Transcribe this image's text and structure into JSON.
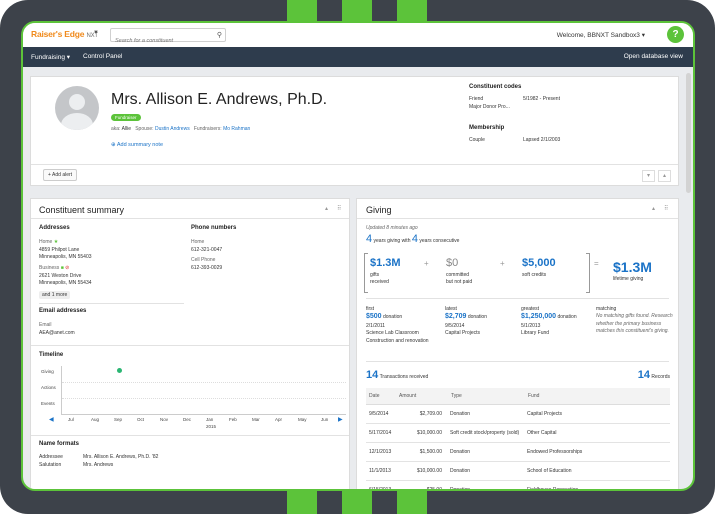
{
  "header": {
    "logo": "Raiser's Edge",
    "logo_suffix": "NXT",
    "search_placeholder": "Search for a constituent",
    "welcome": "Welcome, BBNXT Sandbox3",
    "help": "?"
  },
  "nav": {
    "fundraising": "Fundraising",
    "control_panel": "Control Panel",
    "open_db": "Open database view"
  },
  "profile": {
    "name": "Mrs. Allison E. Andrews, Ph.D.",
    "tag": "Fundraiser",
    "aka_label": "aka:",
    "aka_value": "Allie",
    "spouse_label": "Spouse:",
    "spouse_value": "Dustin Andrews",
    "fundraisers_label": "Fundraisers:",
    "fundraisers_value": "Mo Rahman",
    "add_summary": "Add summary note",
    "add_alert": "Add alert",
    "codes_title": "Constituent codes",
    "codes": [
      {
        "name": "Friend",
        "value": "5/1982 - Present"
      },
      {
        "name": "Major Donor Pro...",
        "value": ""
      }
    ],
    "membership_title": "Membership",
    "membership": {
      "type": "Couple",
      "status": "Lapsed 2/1/2003"
    }
  },
  "summary": {
    "title": "Constituent summary",
    "addresses_title": "Addresses",
    "home_label": "Home",
    "home_line1": "4859 Philpot Lane",
    "home_line2": "Minneapolis, MN 55403",
    "business_label": "Business",
    "business_line1": "2621 Wexton Drive",
    "business_line2": "Minneapolis, MN 55434",
    "more": "and 1 more",
    "phones_title": "Phone numbers",
    "phone_home_label": "Home",
    "phone_home": "612-321-0047",
    "phone_cell_label": "Cell Phone",
    "phone_cell": "612-393-0029",
    "email_title": "Email addresses",
    "email_label": "Email",
    "email_value": "AEA@anet.com",
    "timeline_title": "Timeline",
    "timeline_rows": [
      "Giving",
      "Actions",
      "Events"
    ],
    "timeline_months": [
      "Jul",
      "Aug",
      "Sep",
      "Oct",
      "Nov",
      "Dec",
      "Jan",
      "Feb",
      "Mar",
      "Apr",
      "May",
      "Jun"
    ],
    "timeline_year": "2015",
    "nameformats_title": "Name formats",
    "addressee_label": "Addressee",
    "addressee_value": "Mrs. Allison E. Andrews, Ph.D. '82",
    "salutation_label": "Salutation",
    "salutation_value": "Mrs. Andrews"
  },
  "giving": {
    "title": "Giving",
    "updated": "Updated 8 minutes ago",
    "years_giving": "4",
    "years_giving_text": "years giving with",
    "years_consec": "4",
    "years_consec_text": "years consecutive",
    "gifts_received_value": "$1.3M",
    "gifts_received_label1": "gifts",
    "gifts_received_label2": "received",
    "committed_value": "$0",
    "committed_label1": "committed",
    "committed_label2": "but not paid",
    "soft_value": "$5,000",
    "soft_label": "soft credits",
    "lifetime_value": "$1.3M",
    "lifetime_label": "lifetime giving",
    "first_title": "first",
    "first_amount": "$500",
    "first_type": "donation",
    "first_date": "2/1/2011",
    "first_fund": "Science Lab Classroom Construction and renovation",
    "latest_title": "latest",
    "latest_amount": "$2,709",
    "latest_type": "donation",
    "latest_date": "9/5/2014",
    "latest_fund": "Capital Projects",
    "greatest_title": "greatest",
    "greatest_amount": "$1,250,000",
    "greatest_type": "donation",
    "greatest_date": "5/1/2013",
    "greatest_fund": "Library Fund",
    "matching_title": "matching",
    "matching_text": "No matching gifts found. Research whether the primary business matches this constituent's giving.",
    "transactions_count": "14",
    "transactions_label": "Transactions received",
    "records_count": "14",
    "records_label": "Records",
    "columns": [
      "Date",
      "Amount",
      "Type",
      "Fund"
    ],
    "rows": [
      {
        "date": "9/5/2014",
        "amount": "$2,709.00",
        "type": "Donation",
        "fund": "Capital Projects"
      },
      {
        "date": "5/17/2014",
        "amount": "$10,000.00",
        "type": "Soft credit stock/property (sold)",
        "fund": "Other Capital"
      },
      {
        "date": "12/1/2013",
        "amount": "$1,500.00",
        "type": "Donation",
        "fund": "Endowed Professorships"
      },
      {
        "date": "11/1/2013",
        "amount": "$10,000.00",
        "type": "Donation",
        "fund": "School of Education"
      },
      {
        "date": "6/15/2013",
        "amount": "$25.00",
        "type": "Donation",
        "fund": "Fieldhouse Renovation"
      }
    ]
  }
}
